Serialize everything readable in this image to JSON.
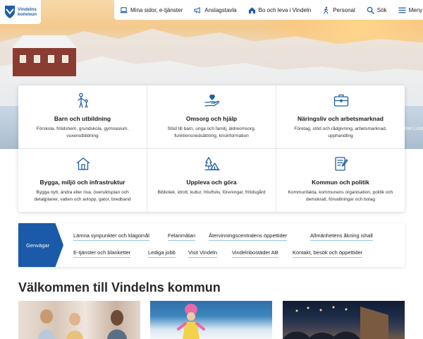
{
  "header": {
    "logo_text": [
      "Vindelns",
      "kommun"
    ],
    "nav": [
      {
        "label": "Mina sidor, e-tjänster",
        "icon": "laptop-icon"
      },
      {
        "label": "Anslagstavla",
        "icon": "megaphone-icon"
      },
      {
        "label": "Bo och leva i Vindeln",
        "icon": "house-icon"
      },
      {
        "label": "Personal",
        "icon": "person-walking-icon"
      },
      {
        "label": "Sök",
        "icon": "search-icon"
      },
      {
        "label": "Meny",
        "icon": "hamburger-menu-icon"
      }
    ]
  },
  "hero": {
    "photo_credit": "Joel Lind"
  },
  "cards": [
    {
      "title": "Barn och utbildning",
      "desc": "Förskola, fritidshem, grundskola, gymnasium, vuxenutbildning",
      "icon": "parent-child-icon"
    },
    {
      "title": "Omsorg och hjälp",
      "desc": "Stöd till barn, unga och familj, äldreomsorg, funktionsnedsättning, krisinformation",
      "icon": "hand-heart-icon"
    },
    {
      "title": "Näringsliv och arbetsmarknad",
      "desc": "Företag, stöd och rådgivning, arbetsmarknad, upphandling",
      "icon": "briefcase-icon"
    },
    {
      "title": "Bygga, miljö och infrastruktur",
      "desc": "Bygga nytt, ändra eller riva, översiktsplan och detaljplaner, vatten och avlopp, gator, bredband",
      "icon": "house-outline-icon"
    },
    {
      "title": "Uppleva och göra",
      "desc": "Bibliotek, idrott, kultur, friluftsliv, föreningar, fritidsgård",
      "icon": "tent-tree-icon"
    },
    {
      "title": "Kommun och politik",
      "desc": "Kommunfakta, kommunens organisation, politik och demokrati, förvaltningar och bolag",
      "icon": "document-pen-icon"
    }
  ],
  "shortcuts": {
    "label": "Genvägar",
    "links": [
      "Lämna synpunkter och klagomål",
      "Felanmälan",
      "Återvinningscentralens öppettider",
      "Allmänhetens åkning ishall",
      "E-tjänster och blanketter",
      "Lediga jobb",
      "Visit Vindeln",
      "Vindelnbostäder AB",
      "Kontakt, besök och öppettider"
    ]
  },
  "welcome": {
    "title": "Välkommen till Vindelns kommun"
  },
  "colors": {
    "brand_blue": "#1a5aa8",
    "icon_blue": "#1f5fa6",
    "link_underline": "#9bc4e8"
  }
}
